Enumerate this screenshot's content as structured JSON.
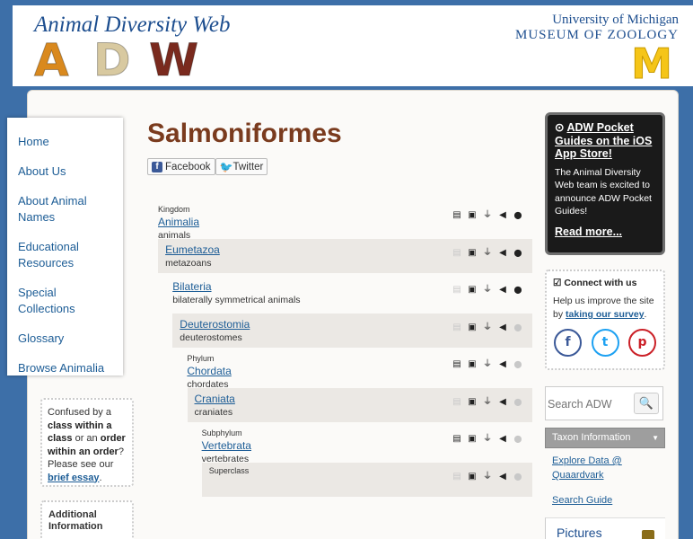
{
  "header": {
    "site_title": "Animal Diversity Web",
    "logo_letters": [
      "A",
      "D",
      "W"
    ],
    "university_line1": "University of Michigan",
    "university_line2": "MUSEUM OF ZOOLOGY",
    "block_m": "M"
  },
  "nav": {
    "items": [
      {
        "label": "Home"
      },
      {
        "label": "About Us"
      },
      {
        "label": "About Animal Names"
      },
      {
        "label": "Educational Resources"
      },
      {
        "label": "Special Collections"
      },
      {
        "label": "Glossary"
      },
      {
        "label": "Browse Animalia"
      }
    ]
  },
  "note_box": {
    "t1": "Confused by a ",
    "b1": "class within a class",
    "t2": " or an ",
    "b2": "order within an order",
    "t3": "? Please see our ",
    "link": "brief essay",
    "t4": "."
  },
  "additional_box": {
    "title": "Additional Information"
  },
  "page": {
    "title": "Salmoniformes"
  },
  "share": {
    "facebook": "Facebook",
    "twitter": "Twitter"
  },
  "taxonomy": [
    {
      "rank": "Kingdom",
      "name": "Animalia",
      "common": "animals",
      "has_text": true,
      "has_map": true
    },
    {
      "rank": "",
      "name": "Eumetazoa",
      "common": "metazoans",
      "has_text": false,
      "has_map": true
    },
    {
      "rank": "",
      "name": "Bilateria",
      "common": "bilaterally symmetrical animals",
      "has_text": false,
      "has_map": true
    },
    {
      "rank": "",
      "name": "Deuterostomia",
      "common": "deuterostomes",
      "has_text": false,
      "has_map": false
    },
    {
      "rank": "Phylum",
      "name": "Chordata",
      "common": "chordates",
      "has_text": true,
      "has_map": false
    },
    {
      "rank": "",
      "name": "Craniata",
      "common": "craniates",
      "has_text": false,
      "has_map": false
    },
    {
      "rank": "Subphylum",
      "name": "Vertebrata",
      "common": "vertebrates",
      "has_text": true,
      "has_map": false
    },
    {
      "rank": "Superclass",
      "name": "",
      "common": "",
      "has_text": false,
      "has_map": false
    }
  ],
  "promo": {
    "title": "ADW Pocket Guides on the iOS App Store!",
    "body": "The Animal Diversity Web team is excited to announce ADW Pocket Guides!",
    "more": "Read more..."
  },
  "connect": {
    "title": "Connect with us",
    "body_prefix": "Help us improve the site by ",
    "survey_link": "taking our survey",
    "body_suffix": ".",
    "facebook_glyph": "f",
    "twitter_glyph": "t",
    "pinterest_glyph": "p"
  },
  "search": {
    "placeholder": "Search ADW",
    "button_glyph": "🔍"
  },
  "taxon_select": {
    "value": "Taxon Information"
  },
  "right_links": {
    "explore": "Explore Data @ Quaardvark",
    "search_guide": "Search Guide"
  },
  "pictures": {
    "label": "Pictures"
  },
  "colors": {
    "background": "#3d6fa8",
    "title_brown": "#7a3b1e",
    "link_blue": "#1d5d96",
    "maize": "#f5c518"
  }
}
